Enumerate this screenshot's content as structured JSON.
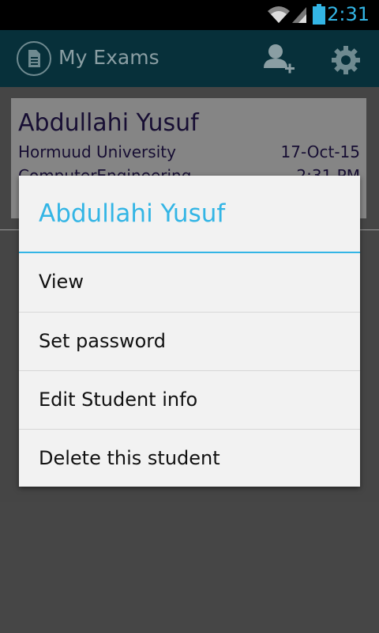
{
  "status_bar": {
    "time": "2:31"
  },
  "action_bar": {
    "title": "My Exams",
    "icons": [
      "document-icon",
      "add-user-icon",
      "gear-icon"
    ]
  },
  "student_card": {
    "name": "Abdullahi Yusuf",
    "university": "Hormuud University",
    "date": "17-Oct-15",
    "department": "ComputerEngineering",
    "time": "2:31 PM"
  },
  "dialog": {
    "title": "Abdullahi Yusuf",
    "items": [
      {
        "label": "View"
      },
      {
        "label": "Set password"
      },
      {
        "label": "Edit Student info"
      },
      {
        "label": "Delete this student"
      }
    ]
  },
  "colors": {
    "accent": "#33b5e5",
    "action_bar": "#07303a",
    "card_text": "#2a1a5e"
  }
}
